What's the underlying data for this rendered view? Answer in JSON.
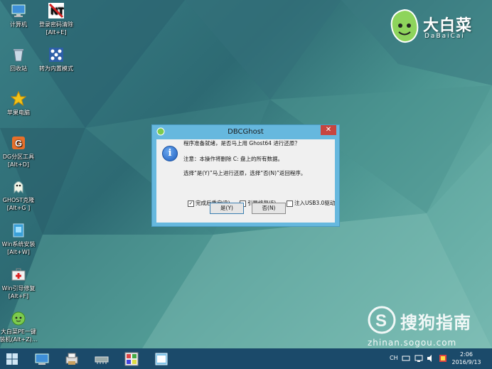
{
  "desktop": {
    "icons": [
      {
        "name": "computer",
        "lines": [
          "计算机"
        ]
      },
      {
        "name": "login-password-clear",
        "lines": [
          "登录密码清除",
          "[Alt+E]"
        ]
      },
      {
        "name": "recycle-bin",
        "lines": [
          "回收站"
        ]
      },
      {
        "name": "switch-kernel-mode",
        "lines": [
          "转为内置模式"
        ]
      },
      {
        "name": "apple-computer",
        "lines": [
          "苹果电脑"
        ]
      },
      {
        "name": "dg-partition-tool",
        "lines": [
          "DG分区工具",
          "[Alt+D]"
        ]
      },
      {
        "name": "ghost-restore",
        "lines": [
          "GHOST克隆",
          "[Alt+G ]"
        ]
      },
      {
        "name": "win-system-install",
        "lines": [
          "Win系统安装",
          "[Alt+W]"
        ]
      },
      {
        "name": "win-boot-repair",
        "lines": [
          "Win引导修复",
          "[Alt+F]"
        ]
      },
      {
        "name": "dabaicai-pe-onekey",
        "lines": [
          "大白菜PE一键",
          "装机(Alt+Z)..."
        ]
      }
    ]
  },
  "brand": {
    "title": "大白菜",
    "subtitle": "DaBaiCai"
  },
  "watermark": {
    "cn": "搜狗指南",
    "url": "zhinan.sogou.com"
  },
  "dialog": {
    "title": "DBCGhost",
    "close": "✕",
    "line1": "程序准备就绪，是否马上用 Ghost64 进行还原？",
    "line2": "注意：本操作将删除 C: 盘上的所有数据。",
    "line3": "选择“是(Y)”马上进行还原，选择“否(N)”返回程序。",
    "checkboxes": [
      {
        "label": "完成后重启(R)",
        "checked": true
      },
      {
        "label": "引导修复(F)",
        "checked": false
      },
      {
        "label": "注入USB3.0驱动",
        "checked": false
      }
    ],
    "yes": "是(Y)",
    "no": "否(N)"
  },
  "taskbar": {
    "ime": "CH",
    "time": "2:06",
    "date": "2016/9/13"
  },
  "colors": {
    "dialog_frame": "#66b8de",
    "close": "#c7453f",
    "taskbar": "#1b4a6a"
  }
}
